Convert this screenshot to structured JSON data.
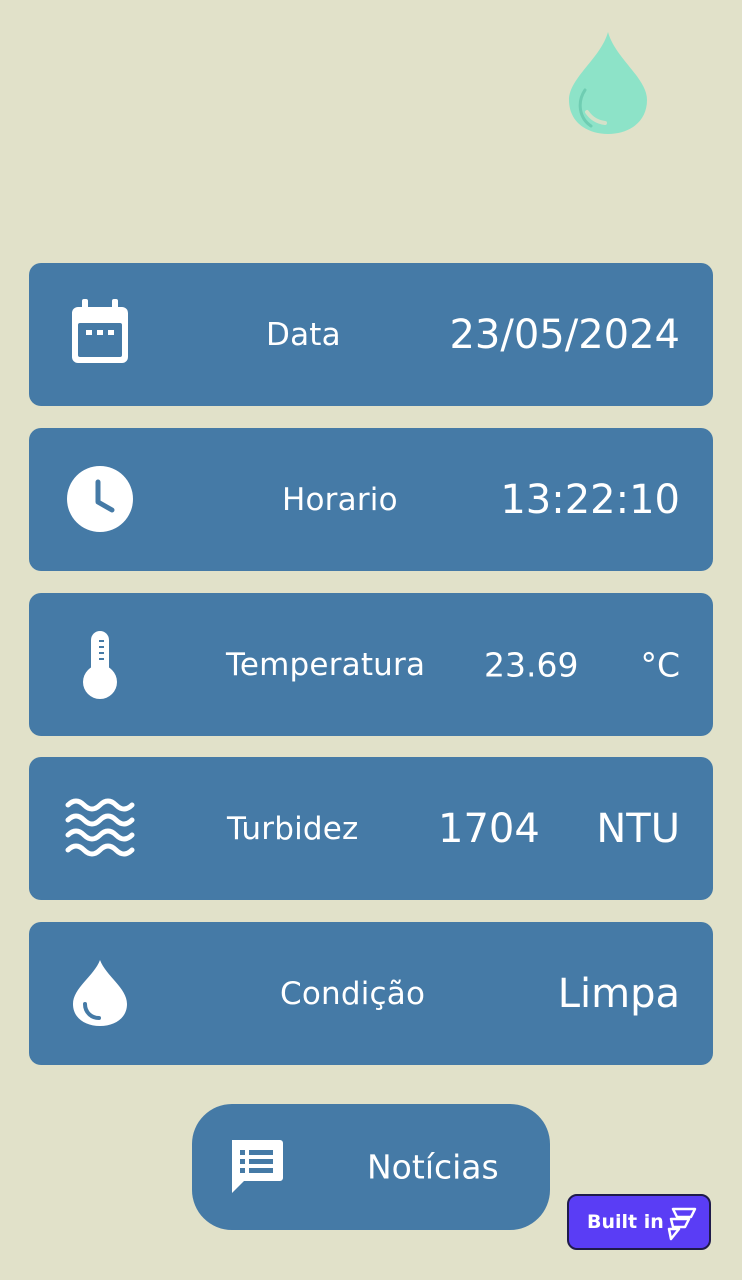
{
  "brand": {
    "logo_icon": "water-drop-logo",
    "logo_color": "#8de3c8"
  },
  "cards": {
    "date": {
      "icon": "calendar-icon",
      "label": "Data",
      "value": "23/05/2024"
    },
    "time": {
      "icon": "clock-icon",
      "label": "Horario",
      "value": "13:22:10"
    },
    "temperature": {
      "icon": "thermometer-icon",
      "label": "Temperatura",
      "value": "23.69",
      "unit": "°C"
    },
    "turbidity": {
      "icon": "waves-icon",
      "label": "Turbidez",
      "value": "1704",
      "unit": "NTU"
    },
    "condition": {
      "icon": "water-drop-icon",
      "label": "Condição",
      "value": "Limpa"
    }
  },
  "news_button": {
    "icon": "message-list-icon",
    "label": "Notícias"
  },
  "built_badge": {
    "label": "Built in",
    "icon": "flutterflow-icon"
  },
  "colors": {
    "background": "#e1e1c9",
    "card": "#457aa6",
    "text": "#ffffff",
    "badge": "#5a3df5"
  }
}
